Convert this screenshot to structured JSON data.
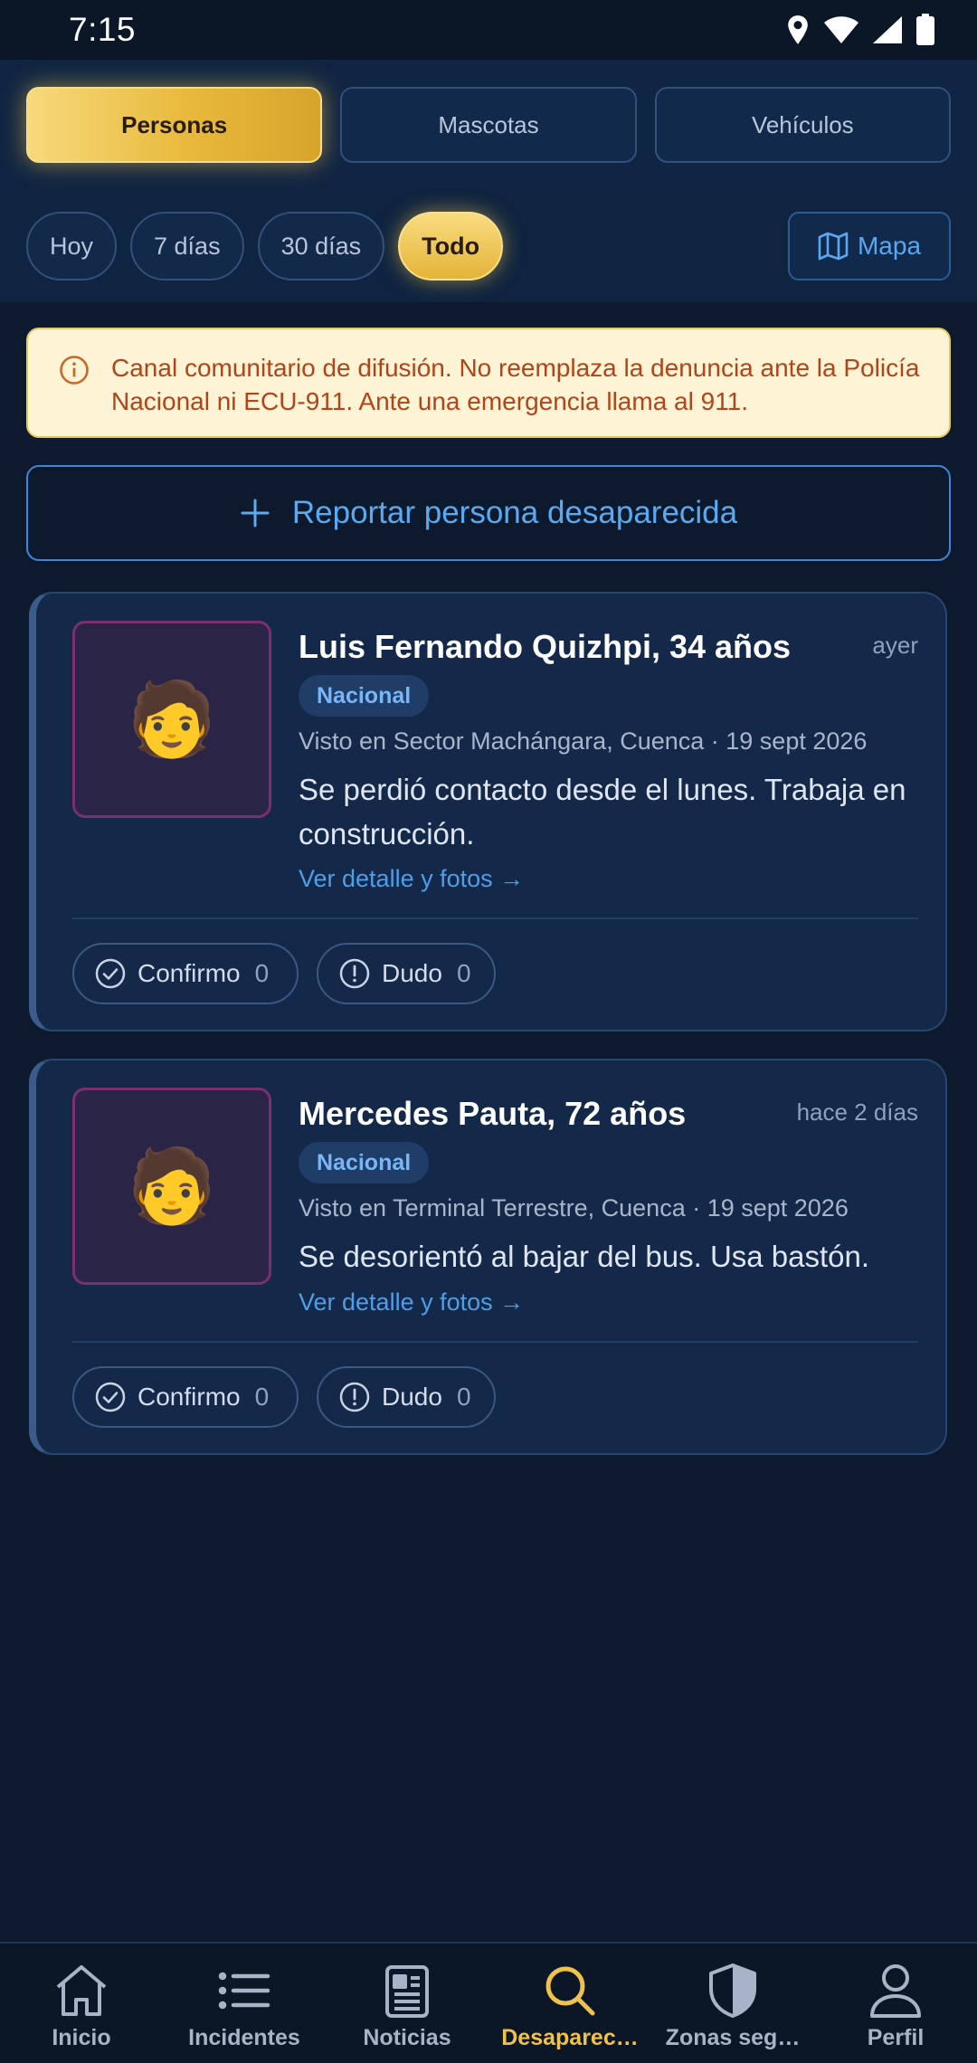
{
  "status_bar": {
    "time": "7:15"
  },
  "type_tabs": [
    {
      "label": "Personas",
      "active": true
    },
    {
      "label": "Mascotas",
      "active": false
    },
    {
      "label": "Vehículos",
      "active": false
    }
  ],
  "date_filters": [
    {
      "label": "Hoy",
      "active": false
    },
    {
      "label": "7 días",
      "active": false
    },
    {
      "label": "30 días",
      "active": false
    },
    {
      "label": "Todo",
      "active": true
    }
  ],
  "map_button": {
    "label": "Mapa"
  },
  "notice": {
    "text": "Canal comunitario de difusión. No reemplaza la denuncia ante la Policía Nacional ni ECU-911. Ante una emergencia llama al 911."
  },
  "report_button": {
    "label": "Reportar persona desaparecida"
  },
  "cards": [
    {
      "photo": "🧑",
      "name": "Luis Fernando Quizhpi, 34 años",
      "when": "ayer",
      "badge": "Nacional",
      "seen": "Visto en Sector Machángara, Cuenca · 19 sept 2026",
      "description": "Se perdió contacto desde el lunes. Trabaja en construcción.",
      "detail_link": "Ver detalle y fotos →",
      "confirm_label": "Confirmo",
      "confirm_count": "0",
      "doubt_label": "Dudo",
      "doubt_count": "0"
    },
    {
      "photo": "🧑",
      "name": "Mercedes Pauta, 72 años",
      "when": "hace 2 días",
      "badge": "Nacional",
      "seen": "Visto en Terminal Terrestre, Cuenca · 19 sept 2026",
      "description": "Se desorientó al bajar del bus. Usa bastón.",
      "detail_link": "Ver detalle y fotos →",
      "confirm_label": "Confirmo",
      "confirm_count": "0",
      "doubt_label": "Dudo",
      "doubt_count": "0"
    }
  ],
  "bottom_nav": [
    {
      "label": "Inicio",
      "icon": "home-icon",
      "active": false
    },
    {
      "label": "Incidentes",
      "icon": "list-icon",
      "active": false
    },
    {
      "label": "Noticias",
      "icon": "newspaper-icon",
      "active": false
    },
    {
      "label": "Desaparec…",
      "icon": "search-icon",
      "active": true
    },
    {
      "label": "Zonas seg…",
      "icon": "shield-icon",
      "active": false
    },
    {
      "label": "Perfil",
      "icon": "person-icon",
      "active": false
    }
  ],
  "colors": {
    "background": "#0d1a2d",
    "accent_gold": "#f1c24a",
    "link_blue": "#4f9ee8",
    "notice_text": "#b24418"
  }
}
